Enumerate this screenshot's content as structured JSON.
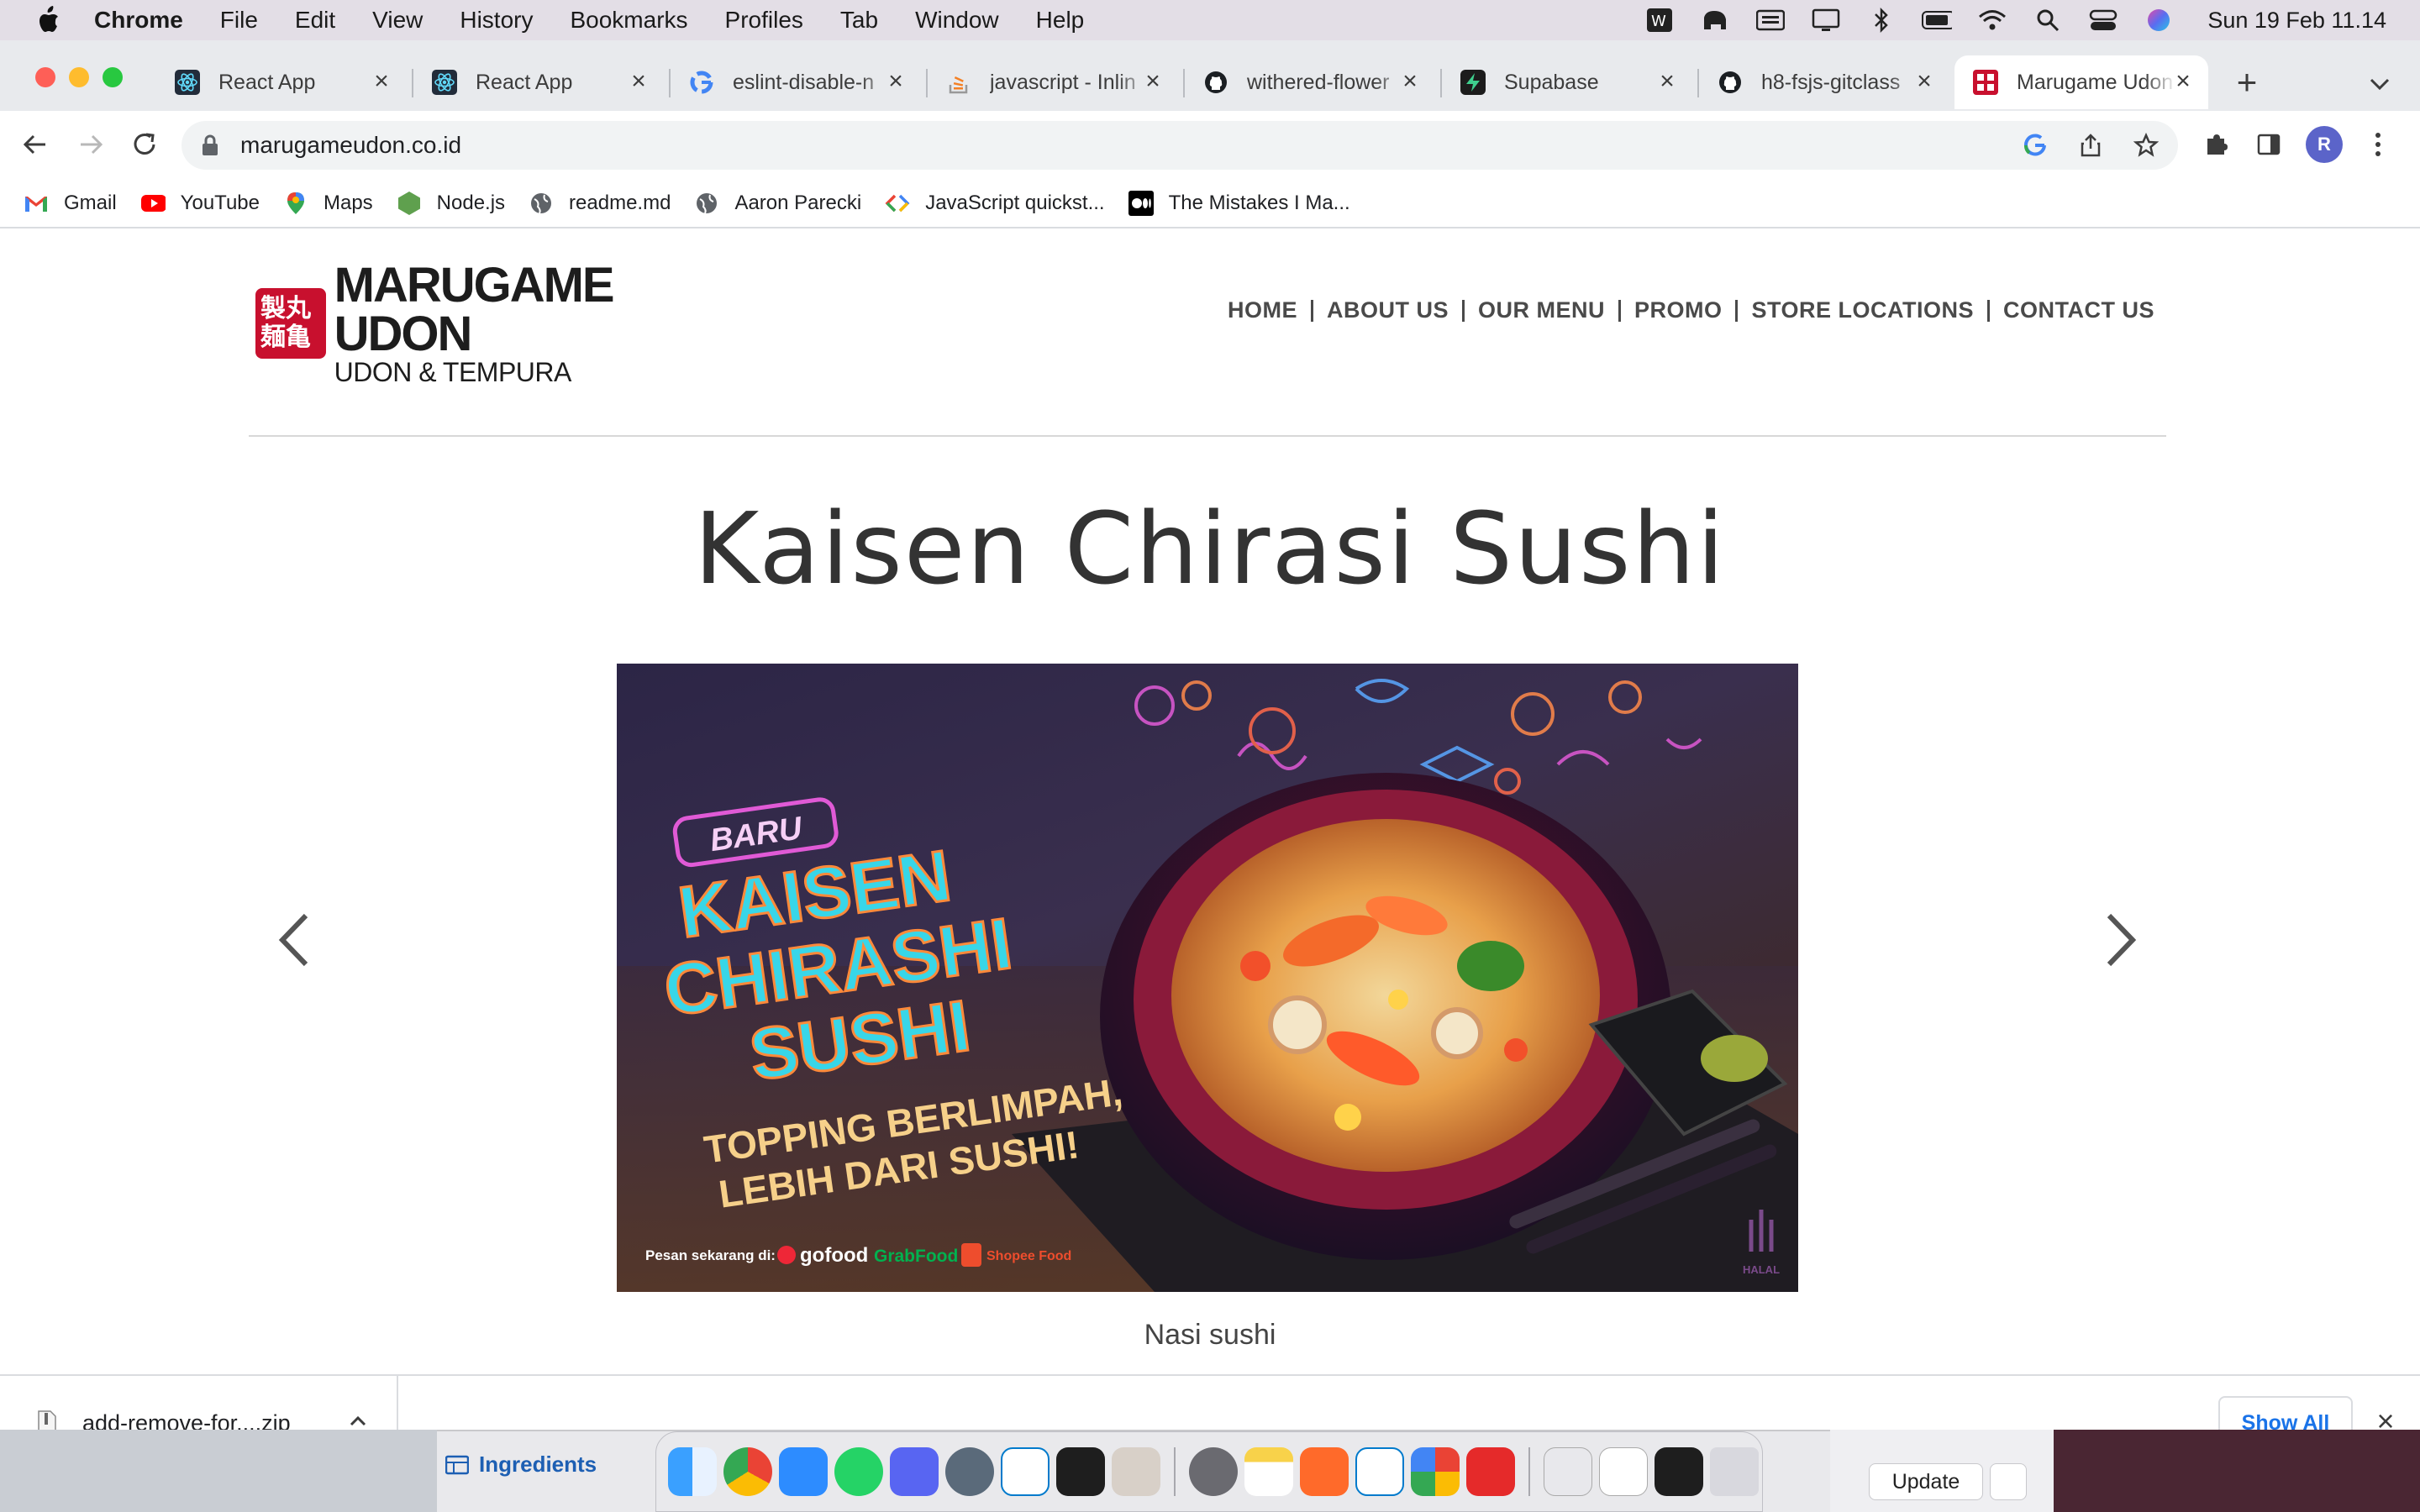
{
  "menubar": {
    "app_name": "Chrome",
    "items": [
      "File",
      "Edit",
      "View",
      "History",
      "Bookmarks",
      "Profiles",
      "Tab",
      "Window",
      "Help"
    ],
    "clock": "Sun 19 Feb  11.14"
  },
  "tabs": [
    {
      "title": "React App",
      "icon": "react-icon"
    },
    {
      "title": "React App",
      "icon": "react-icon"
    },
    {
      "title": "eslint-disable-n",
      "icon": "google-icon"
    },
    {
      "title": "javascript - Inlin",
      "icon": "stackoverflow-icon"
    },
    {
      "title": "withered-flower",
      "icon": "github-icon"
    },
    {
      "title": "Supabase",
      "icon": "supabase-icon"
    },
    {
      "title": "h8-fsjs-gitclass",
      "icon": "github-icon"
    },
    {
      "title": "Marugame Udon",
      "icon": "marugame-icon",
      "active": true
    }
  ],
  "omnibox": {
    "url": "marugameudon.co.id"
  },
  "profile": {
    "initial": "R"
  },
  "bookmarks": [
    {
      "label": "Gmail",
      "icon": "gmail-icon"
    },
    {
      "label": "YouTube",
      "icon": "youtube-icon"
    },
    {
      "label": "Maps",
      "icon": "maps-icon"
    },
    {
      "label": "Node.js",
      "icon": "nodejs-icon"
    },
    {
      "label": "readme.md",
      "icon": "globe-icon"
    },
    {
      "label": "Aaron Parecki",
      "icon": "globe-icon"
    },
    {
      "label": "JavaScript quickst...",
      "icon": "google-dev-icon"
    },
    {
      "label": "The Mistakes I Ma...",
      "icon": "medium-icon"
    }
  ],
  "site": {
    "logo_brand": "MARUGAME UDON",
    "logo_tagline": "UDON & TEMPURA",
    "logo_mark": "製丸麺亀",
    "nav": [
      "HOME",
      "ABOUT US",
      "OUR MENU",
      "PROMO",
      "STORE LOCATIONS",
      "CONTACT US"
    ],
    "hero_title": "Kaisen Chirasi Sushi",
    "caption": "Nasi sushi",
    "banner": {
      "badge": "BARU",
      "headline": [
        "KAISEN",
        "CHIRASHI",
        "SUSHI"
      ],
      "sub": [
        "TOPPING BERLIMPAH,",
        "LEBIH DARI SUSHI!"
      ],
      "order_label": "Pesan sekarang di:",
      "partners": [
        "gofood",
        "GrabFood",
        "Shopee Food"
      ],
      "halal": "HALAL"
    }
  },
  "download_shelf": {
    "file_name": "add-remove-for....zip",
    "show_all": "Show All"
  },
  "background": {
    "sidebar_label": "Ingredients",
    "update_button": "Update"
  },
  "colors": {
    "brand_red": "#c8102e",
    "link_blue": "#1a73e8",
    "neon_cyan": "#38d6e8",
    "neon_pink": "#e05ad6"
  }
}
